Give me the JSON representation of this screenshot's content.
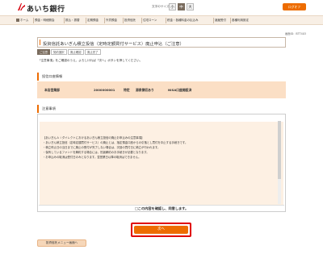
{
  "header": {
    "bank_name": "あいち銀行",
    "font_size_label": "文字のサイズ",
    "font_sizes": [
      "小",
      "中",
      "大"
    ],
    "logout": "ログオフ"
  },
  "nav": {
    "items": [
      "ホーム",
      "預金・明細照会",
      "振込・振替",
      "定期預金",
      "外貨預金",
      "投資信託",
      "住宅ローン",
      "税金・各種料金の払込み",
      "諸届受付",
      "各種利用設定"
    ]
  },
  "page": {
    "screen_no": "画面ID：BTT403",
    "title": "投資信託あいぎん積立投信（定時定額買付サービス）廃止申込（ご注意）",
    "steps": [
      "ご注意",
      "契約選択",
      "廃止確認",
      "廃止完了"
    ],
    "instruction": "「注意事項」をご確認のうえ、よろしければ「次へ」ボタンを押してください。"
  },
  "account": {
    "heading": "投信口座情報",
    "branch": "本店営業部",
    "number": "2000000001",
    "type": "特定",
    "withholding": "源泉徴収あり",
    "nisa": "NISA口座開設済"
  },
  "attention": {
    "heading": "注意事項",
    "lines": [
      "【あいぎんＡｉダイレクトにおけるあいぎん積立投信の廃止お申込みの注意事項】",
      "・あいぎん積立投信（定時定額買付サービス）の廃止とは、指定預金口座からの引落とし買付を中止する手続きです。",
      "・積立停止日の当日までに廃止の受付が完了しない場合は、次回の買付日に積立が行われます。",
      "・保有しているファンドを解約する場合には、別途解約のお手続きが必要となります。",
      "・お申込みの取消は受付日のみとなります。翌営業日以降の取消はできません。"
    ],
    "confirm": "□この内容を確認し、同意します。"
  },
  "buttons": {
    "next": "次へ",
    "back": "投資信託メニュー画面へ"
  },
  "colors": {
    "accent": "#ed6c00",
    "focus_outline": "#e00000",
    "account_bg": "#fbdfc5"
  }
}
